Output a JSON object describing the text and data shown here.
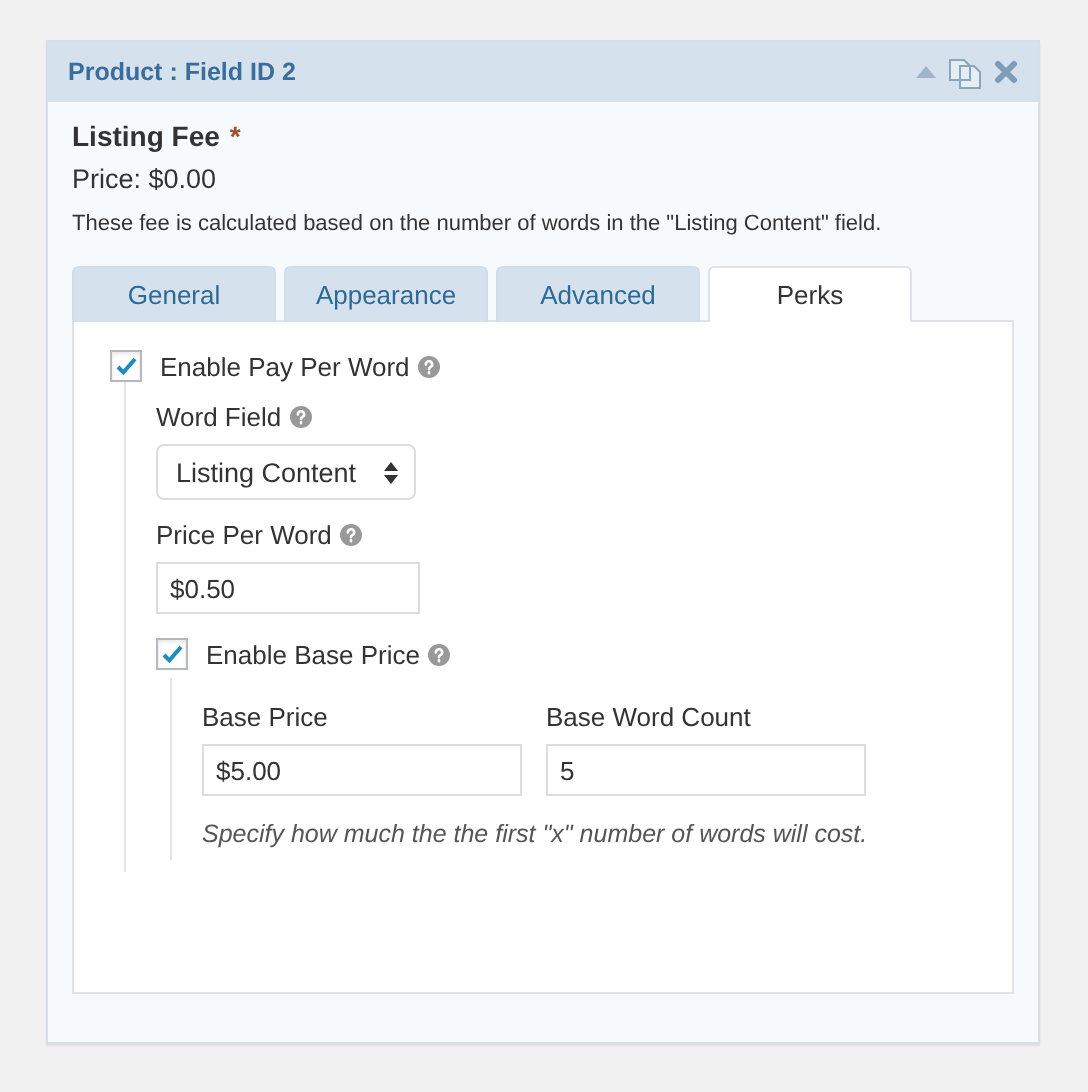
{
  "panel": {
    "title": "Product : Field ID 2"
  },
  "field": {
    "label": "Listing Fee",
    "required": "*",
    "price": "Price: $0.00",
    "description": "These fee is calculated based on the number of words in the \"Listing Content\" field."
  },
  "tabs": [
    {
      "label": "General",
      "selected": false
    },
    {
      "label": "Appearance",
      "selected": false
    },
    {
      "label": "Advanced",
      "selected": false
    },
    {
      "label": "Perks",
      "selected": true
    }
  ],
  "perks": {
    "pay_per_word": {
      "label": "Enable Pay Per Word",
      "checked": true,
      "help": true
    },
    "word_field": {
      "label": "Word Field",
      "help": true,
      "value": "Listing Content"
    },
    "price_per_word": {
      "label": "Price Per Word",
      "help": true,
      "value": "$0.50"
    },
    "base_price_toggle": {
      "label": "Enable Base Price",
      "checked": true,
      "help": true
    },
    "base_fields": [
      {
        "label": "Base Price",
        "value": "$5.00"
      },
      {
        "label": "Base Word Count",
        "value": "5"
      }
    ],
    "note": "Specify how much the the first \"x\" number of words will cost."
  }
}
